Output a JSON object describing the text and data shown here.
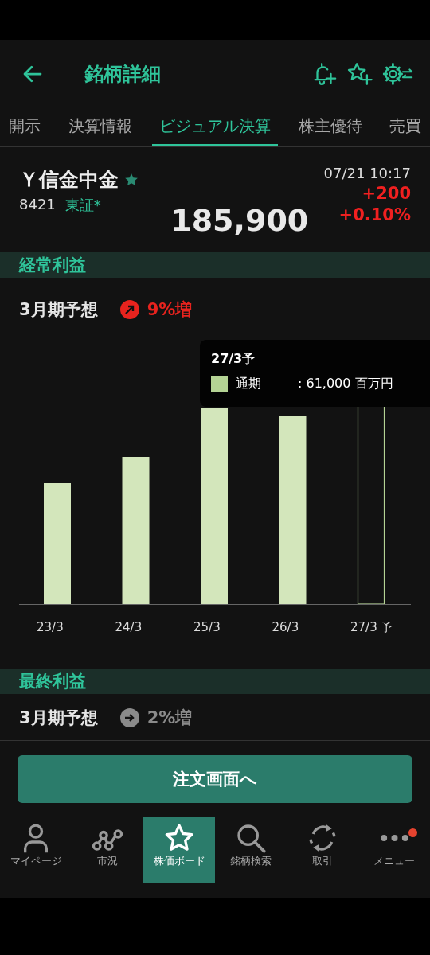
{
  "header": {
    "title": "銘柄詳細"
  },
  "tabs": [
    {
      "label": "開示",
      "selected": false
    },
    {
      "label": "決算情報",
      "selected": false
    },
    {
      "label": "ビジュアル決算",
      "selected": true
    },
    {
      "label": "株主優待",
      "selected": false
    },
    {
      "label": "売買",
      "selected": false
    }
  ],
  "stock": {
    "name": "Ｙ信金中金",
    "favorite": true,
    "code": "8421",
    "market": "東証*",
    "price": "185,900",
    "time": "07/21 10:17",
    "change": "+200",
    "change_pct": "+0.10%"
  },
  "sections": [
    {
      "title": "経常利益",
      "period": "3月期予想",
      "kind": "up",
      "growth": "9%増",
      "chart": {
        "categories": [
          {
            "label": "23/3",
            "forecast": false
          },
          {
            "label": "24/3",
            "forecast": false
          },
          {
            "label": "25/3",
            "forecast": false
          },
          {
            "label": "26/3",
            "forecast": false
          },
          {
            "label": "27/3 予",
            "forecast": true
          }
        ],
        "tooltip": {
          "title": "27/3予",
          "series": "通期",
          "value": ": 61,000 百万円"
        }
      }
    },
    {
      "title": "最終利益",
      "period": "3月期予想",
      "kind": "flat",
      "growth": "2%増"
    }
  ],
  "order_button": "注文画面へ",
  "nav": [
    {
      "label": "マイページ",
      "kind": "person",
      "selected": false,
      "badge": false
    },
    {
      "label": "市況",
      "kind": "chart",
      "selected": false,
      "badge": false
    },
    {
      "label": "株価ボード",
      "kind": "star",
      "selected": true,
      "badge": false
    },
    {
      "label": "銘柄検索",
      "kind": "search",
      "selected": false,
      "badge": false
    },
    {
      "label": "取引",
      "kind": "cycle",
      "selected": false,
      "badge": false
    },
    {
      "label": "メニュー",
      "kind": "dots",
      "selected": false,
      "badge": true
    }
  ]
}
